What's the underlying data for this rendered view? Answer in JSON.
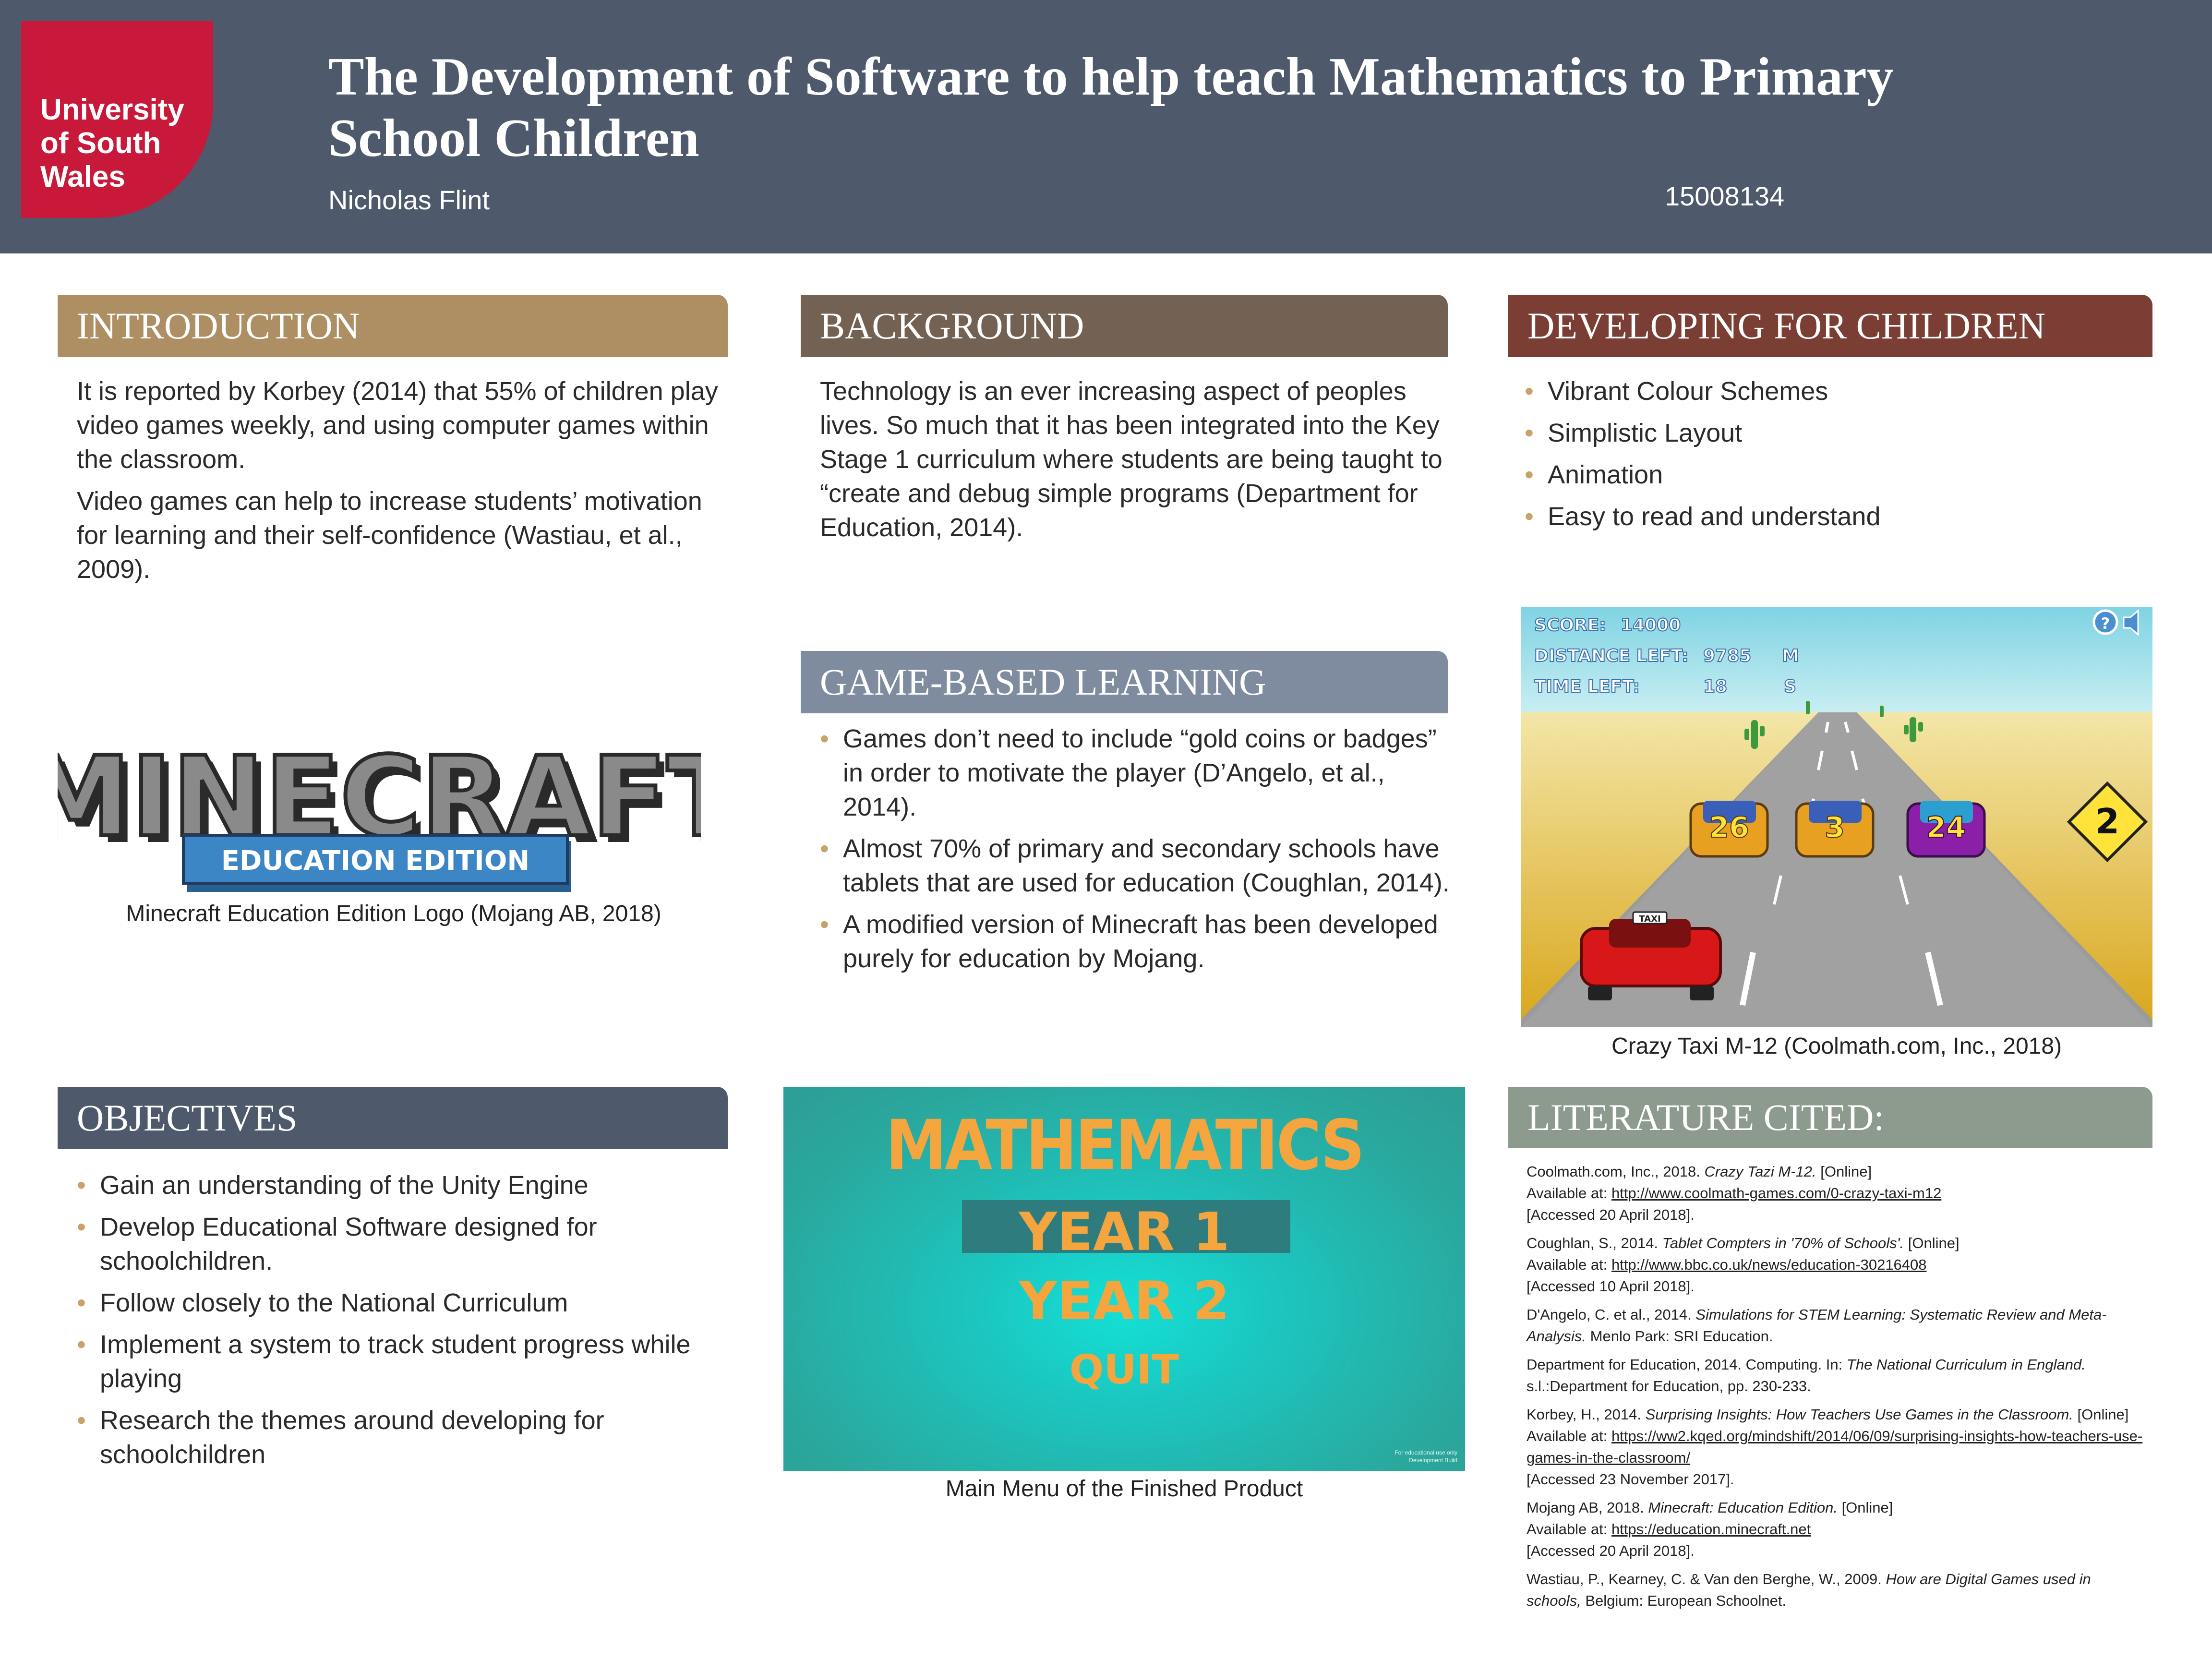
{
  "header": {
    "logo_text": "University\nof South\nWales",
    "title": "The Development of Software to help teach Mathematics to Primary School Children",
    "author": "Nicholas Flint",
    "student_id": "15008134"
  },
  "colors": {
    "header_bg": "#4e5a6b",
    "logo_red": "#c8193a",
    "introduction": "#ad8f63",
    "background": "#736253",
    "developing": "#7a3e34",
    "game_based": "#7f8b9f",
    "objectives": "#4e5a6b",
    "literature": "#8d9a8e",
    "bullet": "#c9a26a"
  },
  "introduction": {
    "heading": "INTRODUCTION",
    "paragraphs": [
      "It is reported by Korbey (2014) that 55% of children play video games weekly, and using computer games within the classroom.",
      "Video games can help to increase students’ motivation for learning and their self-confidence (Wastiau, et al., 2009)."
    ]
  },
  "minecraft": {
    "logo_word": "MINECRAFT",
    "logo_sub": "EDUCATION EDITION",
    "caption": "Minecraft Education Edition Logo (Mojang AB, 2018)"
  },
  "background": {
    "heading": "BACKGROUND",
    "text": "Technology is an ever increasing aspect of peoples lives. So much that it has been integrated into the Key Stage 1 curriculum where students are being taught to “create and debug simple programs (Department for Education, 2014)."
  },
  "game_based": {
    "heading": "GAME-BASED LEARNING",
    "bullets": [
      "Games don’t need to include “gold coins or badges” in order to motivate the player (D’Angelo, et al., 2014).",
      "Almost 70% of primary and secondary schools have tablets that are used for education (Coughlan, 2014).",
      "A modified version of Minecraft has been developed purely for education by Mojang."
    ]
  },
  "developing": {
    "heading": "DEVELOPING FOR CHILDREN",
    "bullets": [
      "Vibrant Colour Schemes",
      "Simplistic Layout",
      "Animation",
      "Easy to read and understand"
    ]
  },
  "taxi_game": {
    "score_label": "SCORE:",
    "score_value": "14000",
    "distance_label": "DISTANCE LEFT:",
    "distance_value": "9785",
    "distance_unit": "M",
    "time_label": "TIME LEFT:",
    "time_value": "18",
    "time_unit": "S",
    "car_numbers": [
      "26",
      "3",
      "24"
    ],
    "sign_number": "2",
    "taxi_sign": "TAXI",
    "caption": "Crazy Taxi M-12 (Coolmath.com, Inc., 2018)"
  },
  "objectives": {
    "heading": "OBJECTIVES",
    "bullets": [
      "Gain an understanding of the Unity Engine",
      "Develop Educational Software designed for schoolchildren.",
      "Follow closely to the National Curriculum",
      "Implement a system to track student progress while playing",
      "Research the themes around developing for schoolchildren"
    ]
  },
  "main_menu": {
    "title": "MATHEMATICS",
    "item1": "YEAR 1",
    "item2": "YEAR 2",
    "item3": "QUIT",
    "footer_line1": "For educational use only",
    "footer_line2": "Development Build",
    "caption": "Main Menu of the Finished Product"
  },
  "literature": {
    "heading": "LITERATURE CITED:",
    "refs": {
      "r1_a": "Coolmath.com, Inc., 2018. ",
      "r1_b": "Crazy Tazi M-12.",
      "r1_c": " [Online]",
      "r1_d": "Available at: ",
      "r1_url": "http://www.coolmath-games.com/0-crazy-taxi-m12",
      "r1_e": "[Accessed 20 April 2018].",
      "r2_a": "Coughlan, S., 2014. ",
      "r2_b": "Tablet Compters in '70% of Schools'.",
      "r2_c": " [Online]",
      "r2_d": "Available at: ",
      "r2_url": "http://www.bbc.co.uk/news/education-30216408",
      "r2_e": "[Accessed 10 April 2018].",
      "r3_a": "D'Angelo, C. et al., 2014. ",
      "r3_b": "Simulations for STEM Learning: Systematic Review and Meta-Analysis.",
      "r3_c": " Menlo Park: SRI Education.",
      "r4_a": "Department for Education, 2014. Computing. In: ",
      "r4_b": "The National Curriculum in England.",
      "r4_c": " s.l.:Department for Education, pp. 230-233.",
      "r5_a": "Korbey, H., 2014. ",
      "r5_b": "Surprising Insights: How Teachers Use Games in the Classroom.",
      "r5_c": " [Online]",
      "r5_d": "Available at: ",
      "r5_url": "https://ww2.kqed.org/mindshift/2014/06/09/surprising-insights-how-teachers-use-games-in-the-classroom/",
      "r5_e": "[Accessed 23 November 2017].",
      "r6_a": "Mojang AB, 2018. ",
      "r6_b": "Minecraft: Education Edition.",
      "r6_c": " [Online]",
      "r6_d": "Available at: ",
      "r6_url": "https://education.minecraft.net",
      "r6_e": "[Accessed 20 April 2018].",
      "r7_a": "Wastiau, P., Kearney, C. & Van den Berghe, W., 2009. ",
      "r7_b": "How are Digital Games used in schools,",
      "r7_c": " Belgium: European Schoolnet."
    }
  }
}
